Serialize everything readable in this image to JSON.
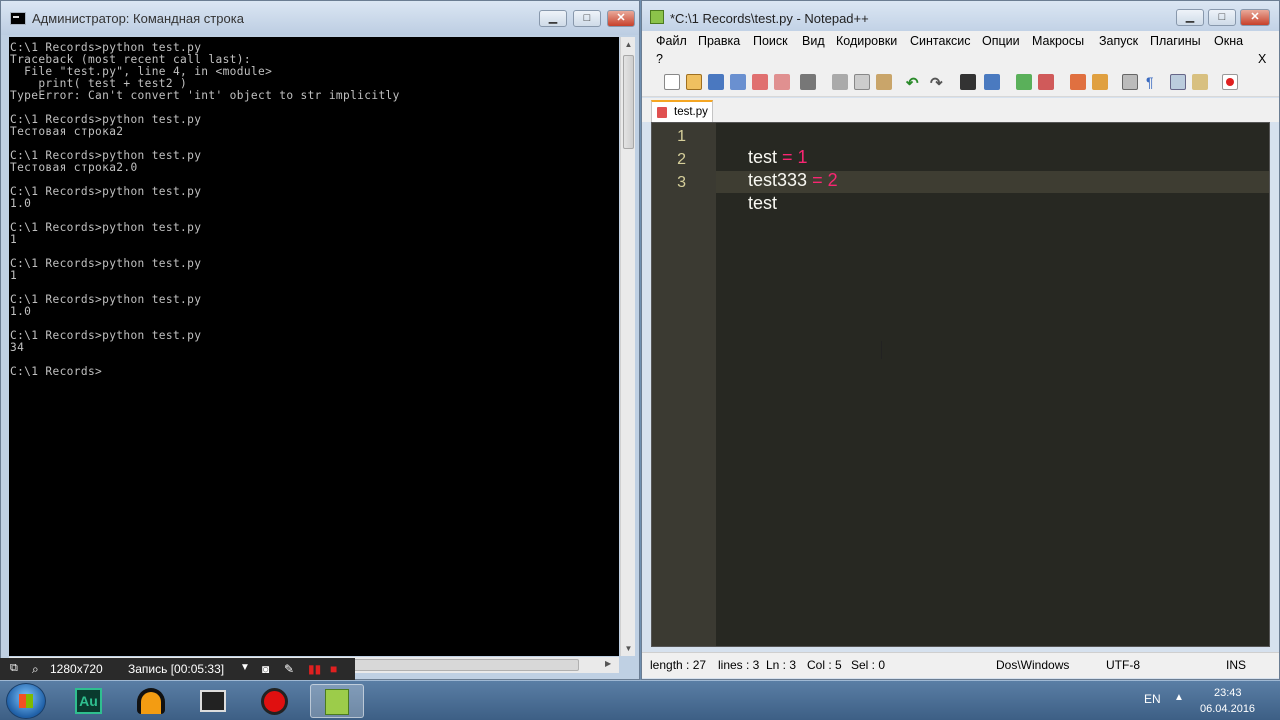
{
  "cmd": {
    "title": "Администратор: Командная строка",
    "console_lines": [
      "C:\\1 Records>python test.py",
      "Traceback (most recent call last):",
      "  File \"test.py\", line 4, in <module>",
      "    print( test + test2 )",
      "TypeError: Can't convert 'int' object to str implicitly",
      "",
      "C:\\1 Records>python test.py",
      "Тестовая строка2",
      "",
      "C:\\1 Records>python test.py",
      "Тестовая строка2.0",
      "",
      "C:\\1 Records>python test.py",
      "1.0",
      "",
      "C:\\1 Records>python test.py",
      "1",
      "",
      "C:\\1 Records>python test.py",
      "1",
      "",
      "C:\\1 Records>python test.py",
      "1.0",
      "",
      "C:\\1 Records>python test.py",
      "34",
      "",
      "C:\\1 Records>"
    ]
  },
  "recorder": {
    "resolution": "1280x720",
    "status": "Запись [00:05:33]"
  },
  "npp": {
    "title": "*C:\\1 Records\\test.py - Notepad++",
    "menu": [
      "Файл",
      "Правка",
      "Поиск",
      "Вид",
      "Кодировки",
      "Синтаксис",
      "Опции",
      "Макросы",
      "Запуск",
      "Плагины",
      "Окна",
      "?"
    ],
    "close_doc": "X",
    "tab_label": "test.py",
    "line_numbers": [
      "1",
      "2",
      "3"
    ],
    "code": [
      {
        "id": "test",
        "op": " = ",
        "num": "1"
      },
      {
        "id": "test333",
        "op": " = ",
        "num": "2"
      },
      {
        "id": "test",
        "op": "",
        "num": ""
      }
    ],
    "status": {
      "length": "length : 27",
      "lines": "lines : 3",
      "ln": "Ln : 3",
      "col": "Col : 5",
      "sel": "Sel : 0",
      "eol": "Dos\\Windows",
      "encoding": "UTF-8",
      "mode": "INS"
    }
  },
  "taskbar": {
    "language": "EN",
    "time": "23:43",
    "date": "06.04.2016"
  },
  "colors": {
    "console_bg": "#000000",
    "console_fg": "#c0c0c0",
    "editor_bg": "#272822",
    "keyword_op": "#f92672",
    "number": "#ae81ff"
  }
}
